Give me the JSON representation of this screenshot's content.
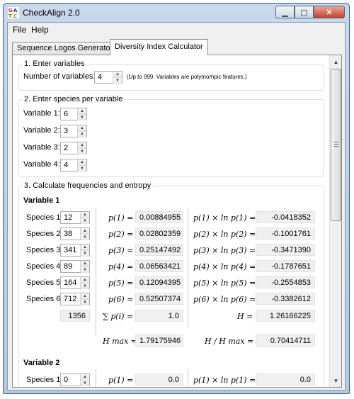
{
  "window": {
    "title": "CheckAlign 2.0"
  },
  "menu": {
    "file": "File",
    "help": "Help"
  },
  "tabs": [
    "Sequence Logos Generator",
    "Diversity Index Calculator"
  ],
  "section1": {
    "legend": "1. Enter variables",
    "num_label": "Number of variables:",
    "num_value": "4",
    "hint": "(Up to 999. Variables are polymorhpic features.)"
  },
  "section2": {
    "legend": "2. Enter species per variable",
    "variables": [
      {
        "label": "Variable 1:",
        "value": "6"
      },
      {
        "label": "Variable 2:",
        "value": "3"
      },
      {
        "label": "Variable 3:",
        "value": "2"
      },
      {
        "label": "Variable 4:",
        "value": "4"
      }
    ]
  },
  "section3": {
    "legend": "3. Calculate frequencies and entropy",
    "var1": {
      "title": "Variable 1",
      "species": [
        {
          "label": "Species 1:",
          "count": "12",
          "p_label": "p(1) =",
          "p": "0.00884955",
          "plnp_label": "p(1) × ln p(1) =",
          "plnp": "-0.0418352"
        },
        {
          "label": "Species 2:",
          "count": "38",
          "p_label": "p(2) =",
          "p": "0.02802359",
          "plnp_label": "p(2) × ln p(2) =",
          "plnp": "-0.1001761"
        },
        {
          "label": "Species 3:",
          "count": "341",
          "p_label": "p(3) =",
          "p": "0.25147492",
          "plnp_label": "p(3) × ln p(3) =",
          "plnp": "-0.3471390"
        },
        {
          "label": "Species 4:",
          "count": "89",
          "p_label": "p(4) =",
          "p": "0.06563421",
          "plnp_label": "p(4) × ln p(4) =",
          "plnp": "-0.1787651"
        },
        {
          "label": "Species 5:",
          "count": "164",
          "p_label": "p(5) =",
          "p": "0.12094395",
          "plnp_label": "p(5) × ln p(5) =",
          "plnp": "-0.2554853"
        },
        {
          "label": "Species 6:",
          "count": "712",
          "p_label": "p(6) =",
          "p": "0.52507374",
          "plnp_label": "p(6) × ln p(6) =",
          "plnp": "-0.3382612"
        }
      ],
      "total": "1356",
      "sum_label": "∑ p(i) =",
      "sum_value": "1.0",
      "h_label": "H =",
      "h_value": "1.26166225",
      "hmax_label": "H max =",
      "hmax_value": "1.79175946",
      "ratio_label": "H / H max =",
      "ratio_value": "0.70414711"
    },
    "var2": {
      "title": "Variable 2",
      "species": [
        {
          "label": "Species 1:",
          "count": "0",
          "p_label": "p(1) =",
          "p": "0.0",
          "plnp_label": "p(1) × ln p(1) =",
          "plnp": "0.0"
        }
      ]
    }
  }
}
